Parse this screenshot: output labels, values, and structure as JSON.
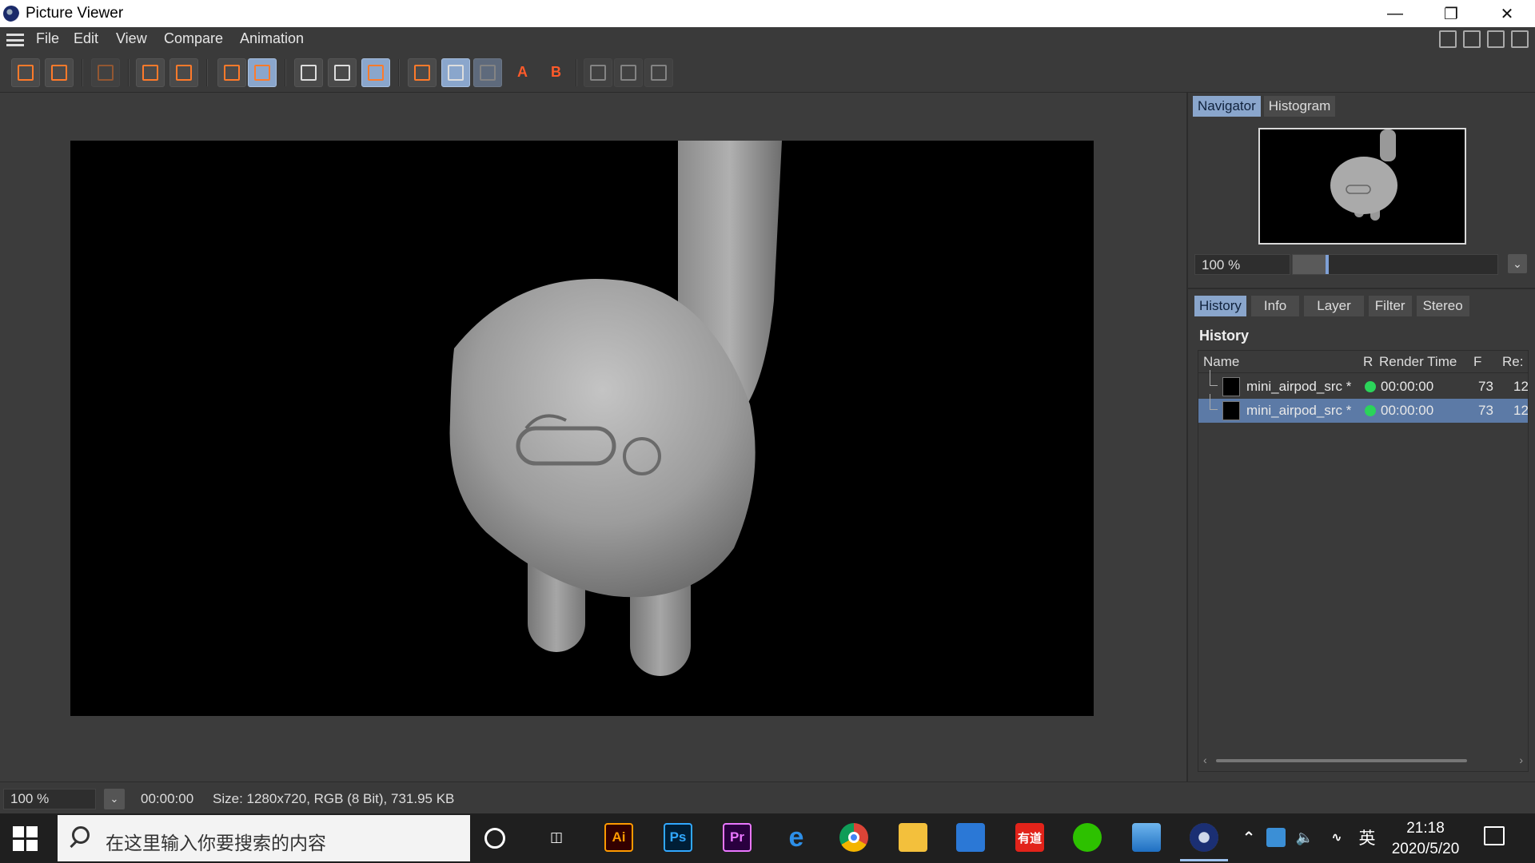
{
  "window": {
    "title": "Picture Viewer",
    "controls": [
      "minimize",
      "restore",
      "close"
    ]
  },
  "menu": {
    "items": [
      "File",
      "Edit",
      "View",
      "Compare",
      "Animation"
    ]
  },
  "toolbar": {
    "buttons": [
      {
        "name": "open-icon"
      },
      {
        "name": "save-icon"
      },
      {
        "name": "stop-icon",
        "disabled": true
      },
      {
        "name": "crop-icon"
      },
      {
        "name": "export-icon"
      },
      {
        "name": "copy-icon"
      },
      {
        "name": "stack-icon",
        "active": true
      },
      {
        "name": "view-region-icon"
      },
      {
        "name": "view-region2-icon"
      },
      {
        "name": "view-region3-icon",
        "active": true
      },
      {
        "name": "ab-icon"
      },
      {
        "name": "ab-split-icon",
        "active": true
      },
      {
        "name": "ab-split2-icon",
        "active": true,
        "disabled": true
      },
      {
        "name": "set-a-icon",
        "label": "A"
      },
      {
        "name": "set-b-icon",
        "label": "B"
      },
      {
        "name": "compare1-icon",
        "disabled": true
      },
      {
        "name": "compare2-icon",
        "disabled": true
      },
      {
        "name": "compare3-icon",
        "disabled": true
      }
    ]
  },
  "navigator": {
    "tabs": [
      "Navigator",
      "Histogram"
    ],
    "active_tab": "Navigator",
    "zoom": "100 %",
    "zoom_fraction": 0.16
  },
  "history": {
    "tabs": [
      "History",
      "Info",
      "Layer",
      "Filter",
      "Stereo"
    ],
    "active_tab": "History",
    "title": "History",
    "columns": [
      "Name",
      "R",
      "Render Time",
      "F",
      "Re:"
    ],
    "rows": [
      {
        "name": "mini_airpod_src *",
        "status": "green",
        "render_time": "00:00:00",
        "f": "73",
        "res": "12",
        "selected": false
      },
      {
        "name": "mini_airpod_src *",
        "status": "green",
        "render_time": "00:00:00",
        "f": "73",
        "res": "12",
        "selected": true
      }
    ]
  },
  "status": {
    "zoom": "100 %",
    "time": "00:00:00",
    "info": "Size: 1280x720, RGB (8 Bit), 731.95 KB"
  },
  "taskbar": {
    "search_placeholder": "在这里输入你要搜索的内容",
    "apps": [
      {
        "name": "cortana-icon"
      },
      {
        "name": "task-view-icon"
      },
      {
        "name": "illustrator-icon",
        "label": "Ai",
        "color": "#ff9a00",
        "bg": "#330000"
      },
      {
        "name": "photoshop-icon",
        "label": "Ps",
        "color": "#31a8ff",
        "bg": "#001e36"
      },
      {
        "name": "premiere-icon",
        "label": "Pr",
        "color": "#ea77ff",
        "bg": "#2a003f"
      },
      {
        "name": "edge-icon"
      },
      {
        "name": "chrome-icon"
      },
      {
        "name": "file-explorer-icon"
      },
      {
        "name": "calendar-icon"
      },
      {
        "name": "youdao-icon",
        "label": "有道"
      },
      {
        "name": "wechat-icon"
      },
      {
        "name": "photos-icon"
      },
      {
        "name": "cinema4d-icon",
        "active": true
      }
    ],
    "ime": "英",
    "time": "21:18",
    "date": "2020/5/20"
  }
}
